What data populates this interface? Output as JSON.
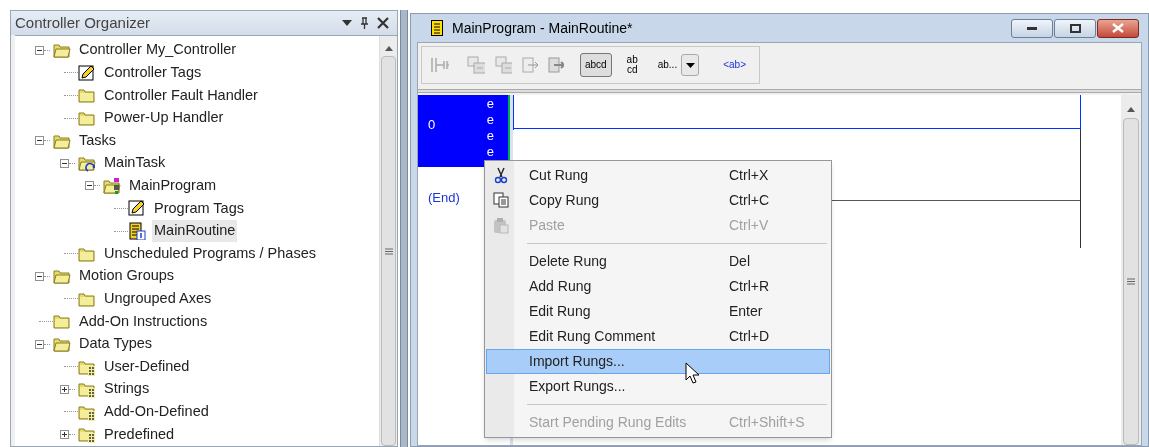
{
  "organizer": {
    "title": "Controller Organizer",
    "tree": [
      {
        "label": "Controller My_Controller",
        "kind": "open-folder",
        "expanded": true,
        "selected": false,
        "children": [
          {
            "label": "Controller Tags",
            "kind": "tags",
            "selected": false
          },
          {
            "label": "Controller Fault Handler",
            "kind": "folder",
            "selected": false
          },
          {
            "label": "Power-Up Handler",
            "kind": "folder",
            "selected": false
          }
        ]
      },
      {
        "label": "Tasks",
        "kind": "open-folder",
        "expanded": true,
        "selected": false,
        "children": [
          {
            "label": "MainTask",
            "kind": "task",
            "expanded": true,
            "selected": false,
            "children": [
              {
                "label": "MainProgram",
                "kind": "program",
                "expanded": true,
                "selected": false,
                "children": [
                  {
                    "label": "Program Tags",
                    "kind": "tags",
                    "selected": false
                  },
                  {
                    "label": "MainRoutine",
                    "kind": "routine",
                    "selected": true
                  }
                ]
              }
            ]
          },
          {
            "label": "Unscheduled Programs / Phases",
            "kind": "folder",
            "selected": false
          }
        ]
      },
      {
        "label": "Motion Groups",
        "kind": "open-folder",
        "expanded": true,
        "selected": false,
        "children": [
          {
            "label": "Ungrouped Axes",
            "kind": "folder",
            "selected": false
          }
        ]
      },
      {
        "label": "Add-On Instructions",
        "kind": "folder",
        "selected": false
      },
      {
        "label": "Data Types",
        "kind": "open-folder",
        "expanded": true,
        "selected": false,
        "children": [
          {
            "label": "User-Defined",
            "kind": "datatype",
            "selected": false
          },
          {
            "label": "Strings",
            "kind": "datatype",
            "expanded": false,
            "selected": false
          },
          {
            "label": "Add-On-Defined",
            "kind": "datatype",
            "selected": false
          },
          {
            "label": "Predefined",
            "kind": "datatype",
            "expanded": false,
            "selected": false
          }
        ]
      }
    ]
  },
  "editor": {
    "title": "MainProgram - MainRoutine*",
    "toolbar_text_buttons": [
      {
        "kind": "toggle",
        "label": "abcd",
        "selected": true
      },
      {
        "kind": "stacked",
        "label": "ab",
        "label2": "cd",
        "selected": false
      },
      {
        "kind": "dropdown",
        "label": "ab...",
        "selected": false
      },
      {
        "kind": "link",
        "label": "<ab>",
        "selected": false
      }
    ],
    "rung": {
      "number": "0",
      "markers": [
        "e",
        "e",
        "e",
        "e"
      ],
      "selected": true
    },
    "end_label": "(End)"
  },
  "context_menu": [
    {
      "kind": "cut",
      "label": "Cut Rung",
      "shortcut": "Ctrl+X",
      "disabled": false,
      "selected": false
    },
    {
      "kind": "copy",
      "label": "Copy Rung",
      "shortcut": "Ctrl+C",
      "disabled": false,
      "selected": false
    },
    {
      "kind": "paste",
      "label": "Paste",
      "shortcut": "Ctrl+V",
      "disabled": true,
      "selected": false
    },
    {
      "kind": "separator"
    },
    {
      "kind": "plain",
      "label": "Delete Rung",
      "shortcut": "Del",
      "disabled": false,
      "selected": false
    },
    {
      "kind": "plain",
      "label": "Add Rung",
      "shortcut": "Ctrl+R",
      "disabled": false,
      "selected": false
    },
    {
      "kind": "plain",
      "label": "Edit Rung",
      "shortcut": "Enter",
      "disabled": false,
      "selected": false
    },
    {
      "kind": "plain",
      "label": "Edit Rung Comment",
      "shortcut": "Ctrl+D",
      "disabled": false,
      "selected": false
    },
    {
      "kind": "plain",
      "label": "Import Rungs...",
      "disabled": false,
      "selected": true
    },
    {
      "kind": "plain",
      "label": "Export Rungs...",
      "disabled": false,
      "selected": false
    },
    {
      "kind": "separator"
    },
    {
      "kind": "plain",
      "label": "Start Pending Rung Edits",
      "shortcut": "Ctrl+Shift+S",
      "disabled": true,
      "selected": false
    }
  ]
}
